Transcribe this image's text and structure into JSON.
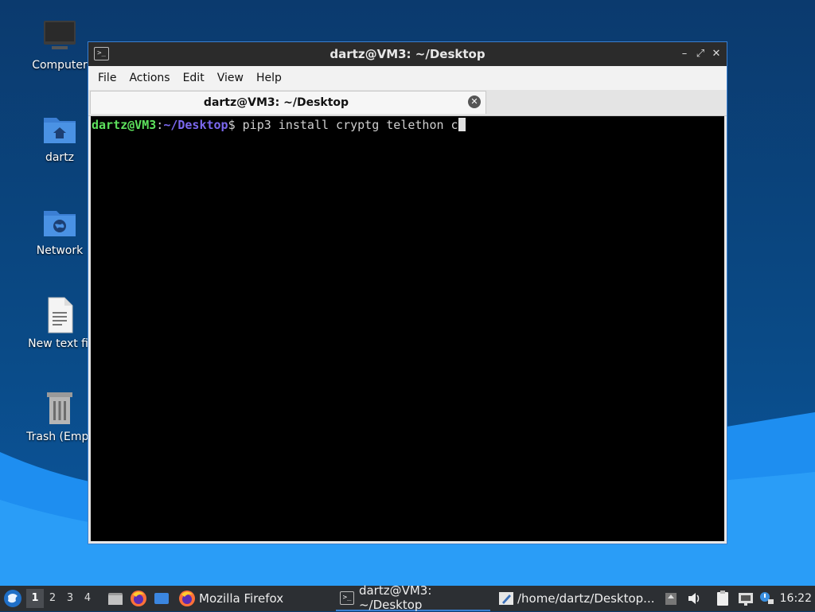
{
  "desktop": {
    "icons": [
      {
        "label": "Computer"
      },
      {
        "label": "dartz"
      },
      {
        "label": "Network"
      },
      {
        "label": "New text fil"
      },
      {
        "label": "Trash (Empt"
      }
    ]
  },
  "window": {
    "title": "dartz@VM3: ~/Desktop",
    "buttons": {
      "minimize": "–",
      "maximize": "⤢",
      "close": "✕"
    },
    "menu": [
      "File",
      "Actions",
      "Edit",
      "View",
      "Help"
    ],
    "tab": {
      "label": "dartz@VM3: ~/Desktop"
    },
    "terminal": {
      "prompt_user": "dartz@VM3",
      "prompt_colon": ":",
      "prompt_path": "~/Desktop",
      "prompt_symbol": "$",
      "command": " pip3 install cryptg telethon c"
    }
  },
  "taskbar": {
    "workspaces": [
      "1",
      "2",
      "3",
      "4"
    ],
    "active_workspace": "1",
    "tasks": [
      {
        "label": "Mozilla Firefox",
        "icon": "firefox-icon"
      },
      {
        "label": "dartz@VM3: ~/Desktop",
        "icon": "terminal-icon",
        "active": true
      },
      {
        "label": "/home/dartz/Desktop...",
        "icon": "editor-icon"
      }
    ],
    "clock": "16:22"
  },
  "colors": {
    "accent": "#3a7fd0",
    "prompt_user": "#5de05d",
    "prompt_path": "#7b68ee"
  }
}
